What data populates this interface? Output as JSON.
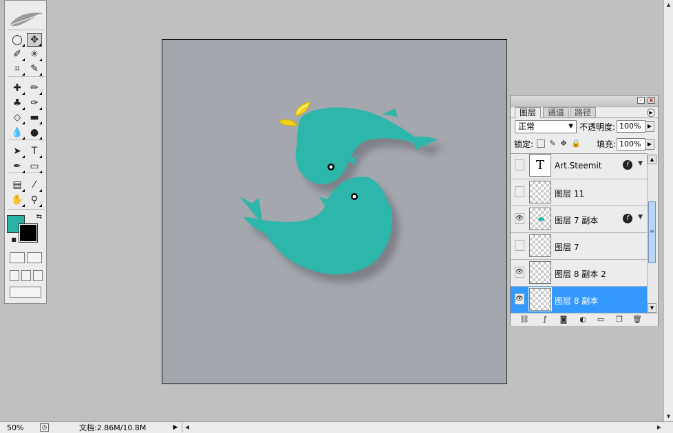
{
  "app": {
    "accent_color": "#3399ff",
    "canvas_bg": "#a4a7ae",
    "workspace_bg": "#c0c0c0"
  },
  "toolbox": {
    "tools": [
      {
        "name": "elliptical-marquee-icon",
        "glyph": "◯"
      },
      {
        "name": "move-tool-icon",
        "glyph": "✥"
      },
      {
        "name": "polygonal-lasso-icon",
        "glyph": "✐"
      },
      {
        "name": "magic-wand-icon",
        "glyph": "✳"
      },
      {
        "name": "crop-icon",
        "glyph": "⌗"
      },
      {
        "name": "slice-icon",
        "glyph": "✎"
      },
      {
        "name": "healing-brush-icon",
        "glyph": "✚"
      },
      {
        "name": "brush-icon",
        "glyph": "✏"
      },
      {
        "name": "clone-stamp-icon",
        "glyph": "♣"
      },
      {
        "name": "history-brush-icon",
        "glyph": "✑"
      },
      {
        "name": "eraser-icon",
        "glyph": "◇"
      },
      {
        "name": "gradient-icon",
        "glyph": "▬"
      },
      {
        "name": "blur-icon",
        "glyph": "💧"
      },
      {
        "name": "dodge-icon",
        "glyph": "●"
      },
      {
        "name": "path-selection-icon",
        "glyph": "➤"
      },
      {
        "name": "type-tool-icon",
        "glyph": "T"
      },
      {
        "name": "pen-tool-icon",
        "glyph": "✒"
      },
      {
        "name": "rectangle-tool-icon",
        "glyph": "▭"
      },
      {
        "name": "notes-icon",
        "glyph": "▤"
      },
      {
        "name": "eyedropper-icon",
        "glyph": "⁄"
      },
      {
        "name": "hand-tool-icon",
        "glyph": "✋"
      },
      {
        "name": "zoom-tool-icon",
        "glyph": "⚲"
      }
    ],
    "foreground_color": "#2ab3a5",
    "background_color": "#000000"
  },
  "layers_panel": {
    "tabs": [
      "图层",
      "通道",
      "路径"
    ],
    "blend_mode": "正常",
    "opacity_label": "不透明度:",
    "opacity_value": "100%",
    "lock_label": "锁定:",
    "fill_label": "填充:",
    "fill_value": "100%",
    "layers": [
      {
        "name": "Art.Steemit",
        "visible": false,
        "type": "text",
        "fx": true,
        "selected": false,
        "thumb_text": "T"
      },
      {
        "name": "图层 11",
        "visible": false,
        "type": "pixel",
        "fx": false,
        "selected": false
      },
      {
        "name": "图层 7 副本",
        "visible": true,
        "type": "pixel",
        "fx": true,
        "selected": false
      },
      {
        "name": "图层 7",
        "visible": false,
        "type": "pixel",
        "fx": false,
        "selected": false
      },
      {
        "name": "图层 8 副本 2",
        "visible": true,
        "type": "pixel",
        "fx": false,
        "selected": false
      },
      {
        "name": "图层 8 副本",
        "visible": true,
        "type": "pixel",
        "fx": false,
        "selected": true
      }
    ],
    "bottom_icons": [
      "link-icon",
      "fx-icon",
      "mask-icon",
      "adjustment-icon",
      "group-folder-icon",
      "new-layer-icon",
      "trash-icon"
    ]
  },
  "statusbar": {
    "zoom": "50%",
    "doc_info": "文档:2.86M/10.8M"
  }
}
